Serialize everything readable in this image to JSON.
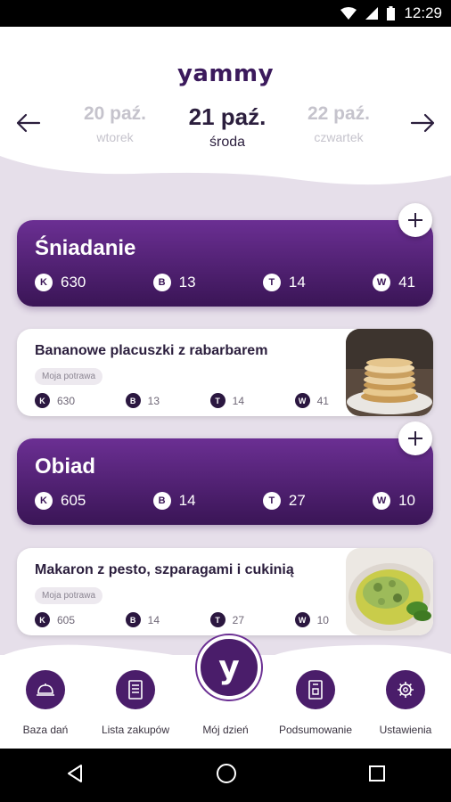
{
  "status": {
    "time": "12:29"
  },
  "app": {
    "logo": "yammy"
  },
  "dates": {
    "prev": {
      "day": "20 paź.",
      "weekday": "wtorek"
    },
    "current": {
      "day": "21 paź.",
      "weekday": "środa"
    },
    "next": {
      "day": "22 paź.",
      "weekday": "czwartek"
    }
  },
  "meals": [
    {
      "title": "Śniadanie",
      "macros": [
        {
          "badge": "K",
          "value": "630"
        },
        {
          "badge": "B",
          "value": "13"
        },
        {
          "badge": "T",
          "value": "14"
        },
        {
          "badge": "W",
          "value": "41"
        }
      ]
    },
    {
      "title": "Obiad",
      "macros": [
        {
          "badge": "K",
          "value": "605"
        },
        {
          "badge": "B",
          "value": "14"
        },
        {
          "badge": "T",
          "value": "27"
        },
        {
          "badge": "W",
          "value": "10"
        }
      ]
    }
  ],
  "dishes": [
    {
      "name": "Bananowe placuszki z rabarbarem",
      "tag": "Moja potrawa",
      "macros": [
        {
          "badge": "K",
          "value": "630"
        },
        {
          "badge": "B",
          "value": "13"
        },
        {
          "badge": "T",
          "value": "14"
        },
        {
          "badge": "W",
          "value": "41"
        }
      ]
    },
    {
      "name": "Makaron z pesto, szparagami i cukinią",
      "tag": "Moja potrawa",
      "macros": [
        {
          "badge": "K",
          "value": "605"
        },
        {
          "badge": "B",
          "value": "14"
        },
        {
          "badge": "T",
          "value": "27"
        },
        {
          "badge": "W",
          "value": "10"
        }
      ]
    }
  ],
  "nav": {
    "items": [
      {
        "label": "Baza dań",
        "icon": "cloche-icon"
      },
      {
        "label": "Lista zakupów",
        "icon": "list-icon"
      },
      {
        "label": "Mój dzień",
        "icon": "yammy-icon"
      },
      {
        "label": "Podsumowanie",
        "icon": "summary-icon"
      },
      {
        "label": "Ustawienia",
        "icon": "gear-icon"
      }
    ],
    "center_glyph": "y"
  },
  "colors": {
    "accent": "#4a1d6a",
    "background": "#e6dfea"
  }
}
